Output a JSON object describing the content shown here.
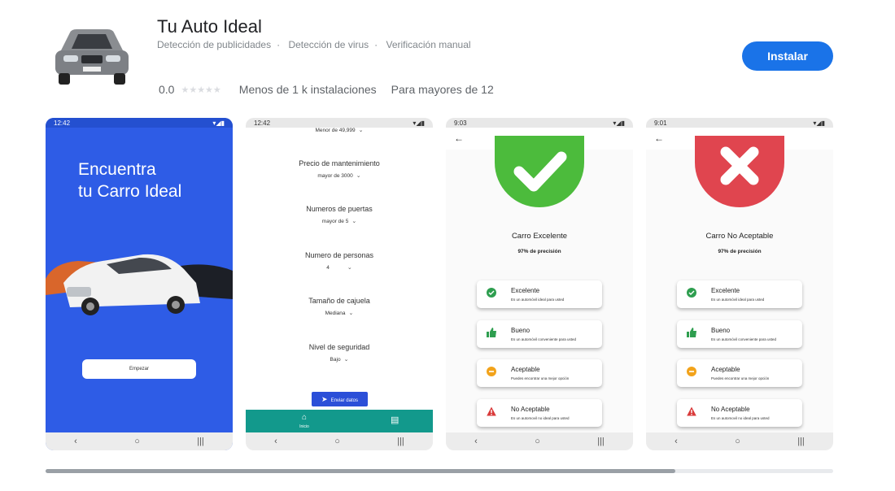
{
  "app": {
    "title": "Tu Auto Ideal",
    "badges": [
      "Detección de publicidades",
      "Detección de virus",
      "Verificación manual"
    ],
    "install_label": "Instalar",
    "rating": "0.0",
    "installs": "Menos de 1 k instalaciones",
    "age": "Para mayores de 12",
    "accent_color": "#1a73e8"
  },
  "screenshots": {
    "shot1": {
      "time": "12:42",
      "headline_line1": "Encuentra",
      "headline_line2": "tu Carro Ideal",
      "start_label": "Empezar"
    },
    "shot2": {
      "time": "12:42",
      "top_value": "Menor de 49,999",
      "fields": [
        {
          "label": "Precio de mantenimiento",
          "value": "mayor de 3000"
        },
        {
          "label": "Numeros de puertas",
          "value": "mayor de 5"
        },
        {
          "label": "Numero de personas",
          "value": "4"
        },
        {
          "label": "Tamaño de cajuela",
          "value": "Mediana"
        },
        {
          "label": "Nivel de seguridad",
          "value": "Bajo"
        }
      ],
      "send_label": "Enviar datos",
      "home_label": "Inicio",
      "bar_color": "#12998c"
    },
    "shot3": {
      "time": "9:03",
      "result": "Carro Excelente",
      "precision": "97% de precisión",
      "circle_color": "#4cbb3c"
    },
    "shot4": {
      "time": "9:01",
      "result": "Carro No Aceptable",
      "precision": "97% de precisión",
      "circle_color": "#e0454f"
    },
    "cards": [
      {
        "title": "Excelente",
        "desc": "Es un automóvil ideal para usted",
        "icon": "check-circle-icon"
      },
      {
        "title": "Bueno",
        "desc": "Es un automóvil conveniente para usted",
        "icon": "thumbs-up-icon"
      },
      {
        "title": "Aceptable",
        "desc": "Puedes encontrar una mejor opción",
        "icon": "minus-circle-icon"
      },
      {
        "title": "No Aceptable",
        "desc": "Es un automovil no ideal para usted",
        "icon": "warning-icon"
      }
    ]
  },
  "carousel": {
    "scroll_fraction": 0.8
  }
}
